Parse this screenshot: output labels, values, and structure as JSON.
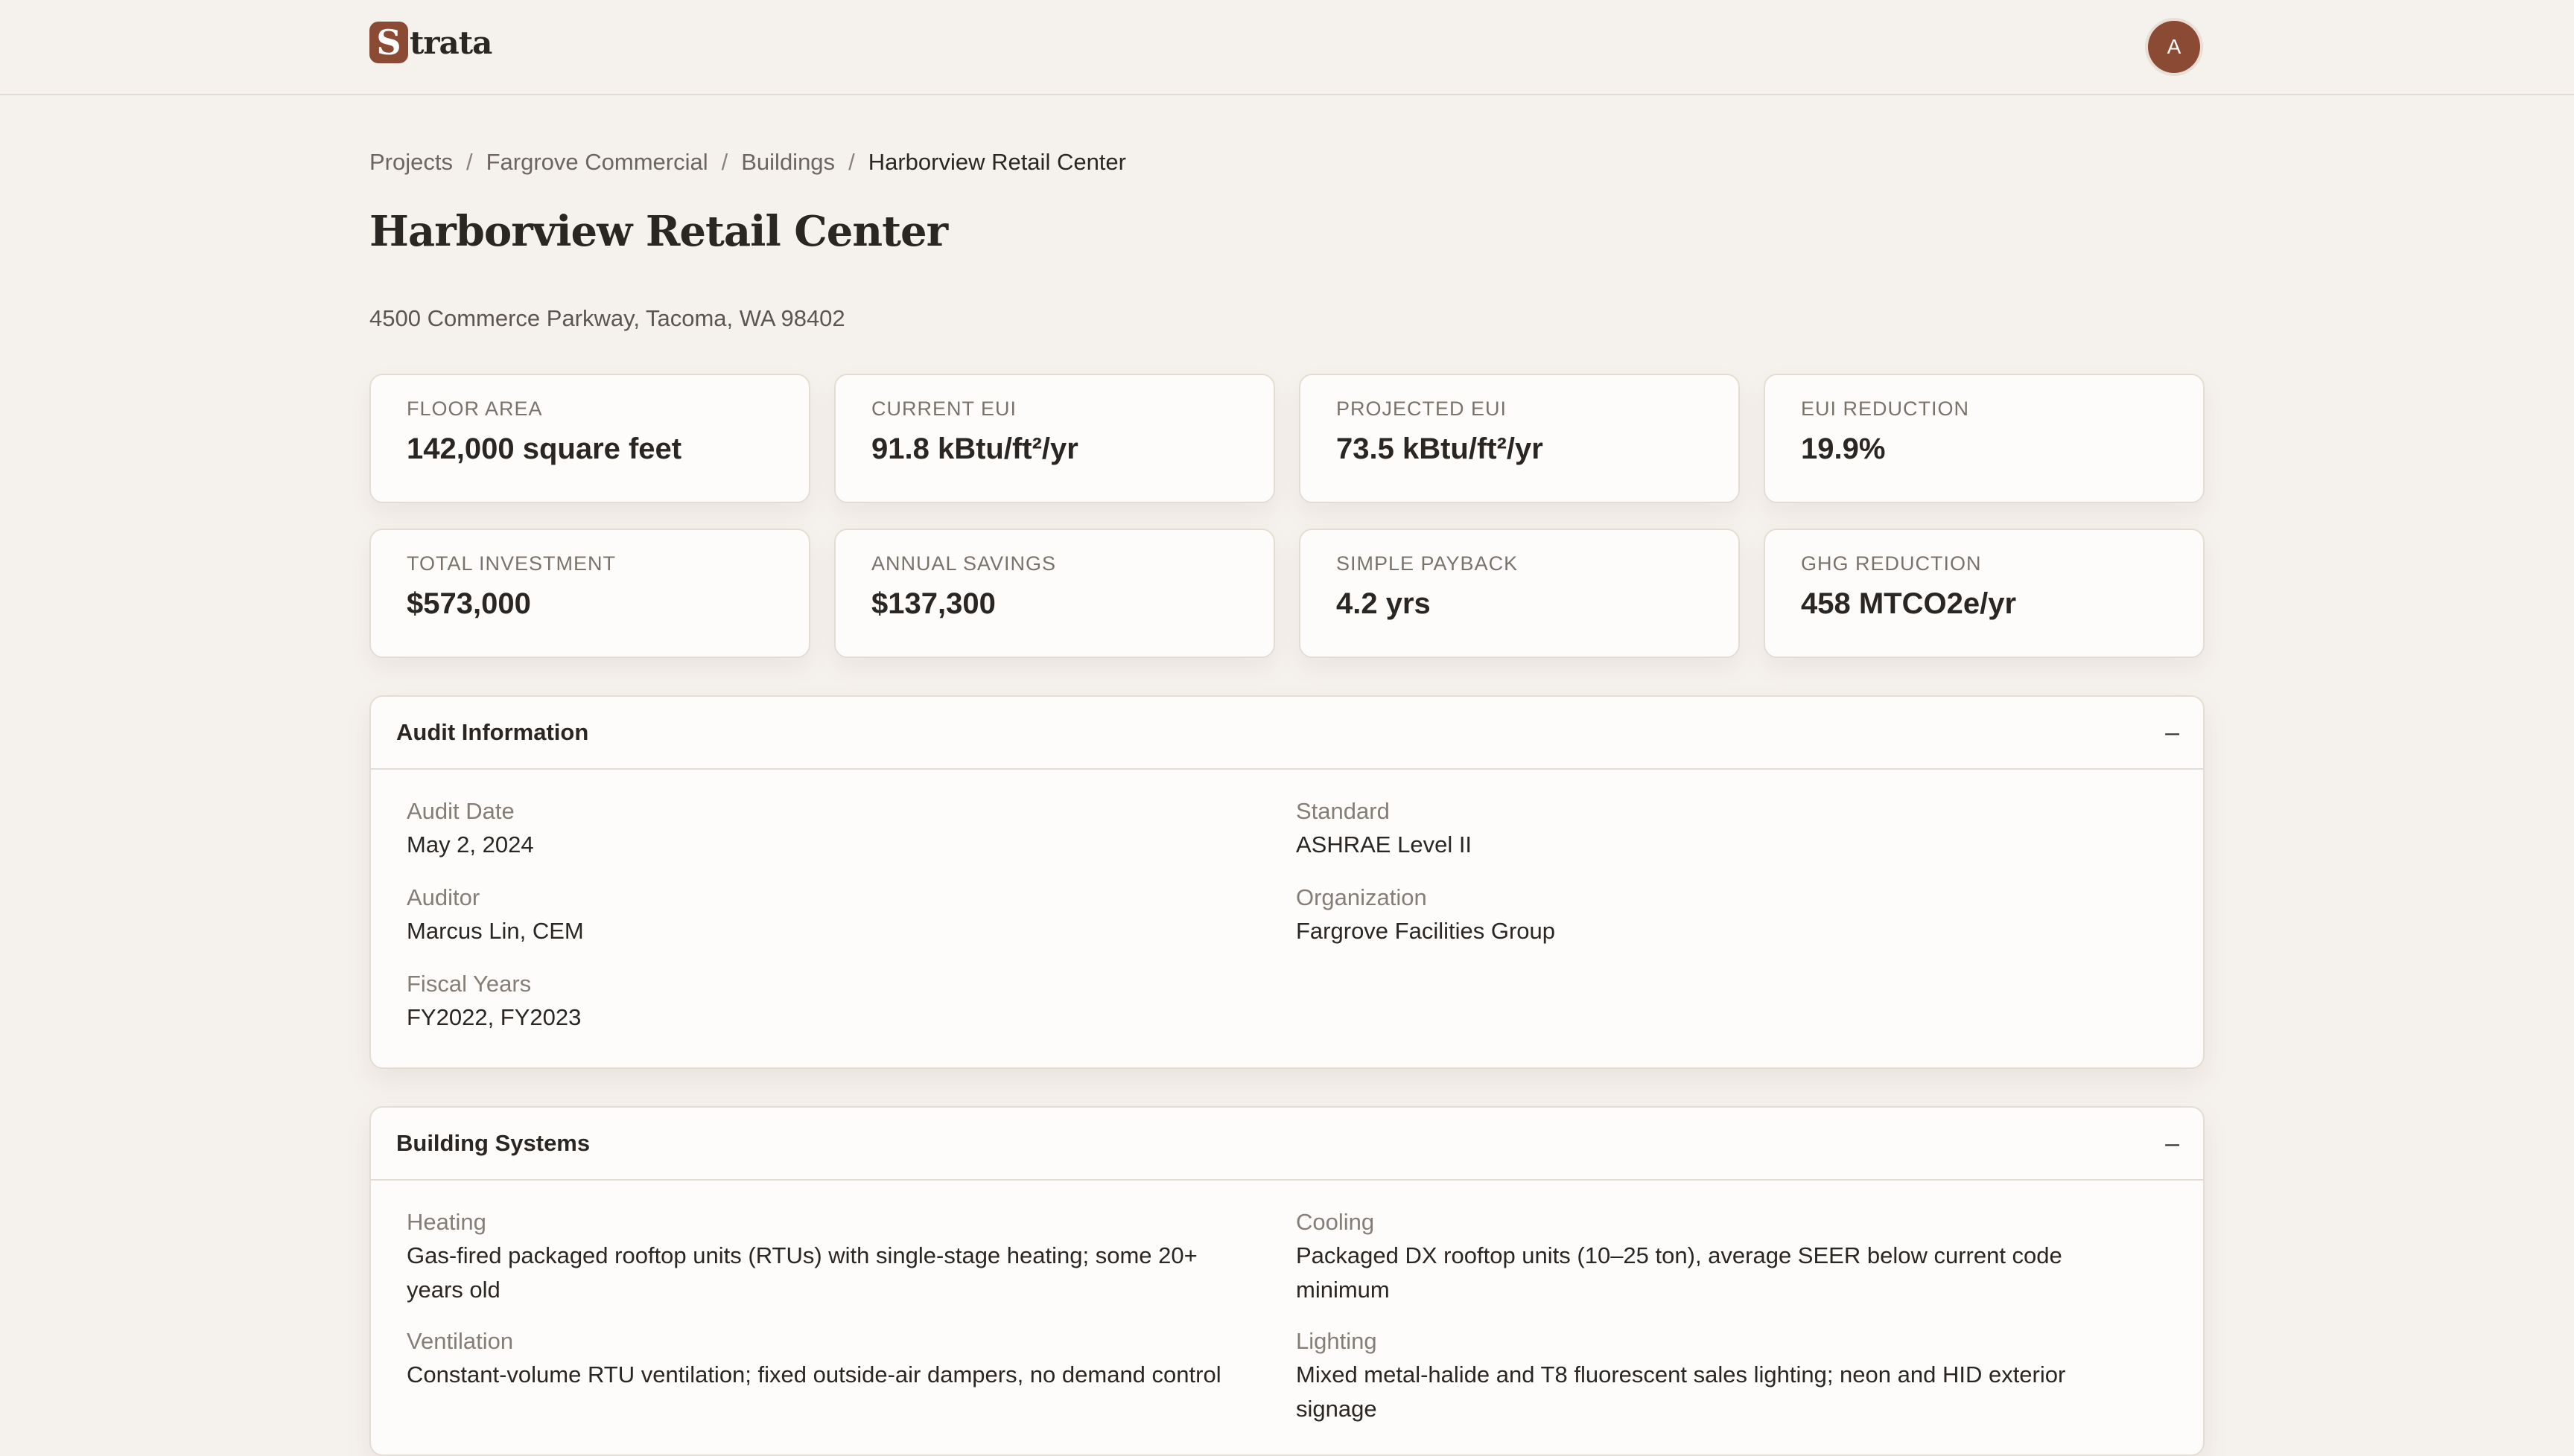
{
  "app": {
    "logo_letter": "S",
    "logo_text": "trata",
    "user_initial": "A"
  },
  "breadcrumb": [
    "Projects",
    "Fargrove Commercial",
    "Buildings",
    "Harborview Retail Center"
  ],
  "building": {
    "title": "Harborview Retail Center",
    "address": "4500 Commerce Parkway, Tacoma, WA 98402"
  },
  "stats": [
    {
      "label": "FLOOR AREA",
      "value": "142,000 square feet"
    },
    {
      "label": "CURRENT EUI",
      "value": "91.8 kBtu/ft²/yr"
    },
    {
      "label": "PROJECTED EUI",
      "value": "73.5 kBtu/ft²/yr"
    },
    {
      "label": "EUI REDUCTION",
      "value": "19.9%"
    },
    {
      "label": "TOTAL INVESTMENT",
      "value": "$573,000"
    },
    {
      "label": "ANNUAL SAVINGS",
      "value": "$137,300"
    },
    {
      "label": "SIMPLE PAYBACK",
      "value": "4.2 yrs"
    },
    {
      "label": "GHG REDUCTION",
      "value": "458 MTCO2e/yr"
    }
  ],
  "audit": {
    "title": "Audit Information",
    "toggle": "–",
    "fields": [
      {
        "label": "Audit Date",
        "value": "May 2, 2024"
      },
      {
        "label": "Standard",
        "value": "ASHRAE Level II"
      },
      {
        "label": "Auditor",
        "value": "Marcus Lin, CEM"
      },
      {
        "label": "Organization",
        "value": "Fargrove Facilities Group"
      },
      {
        "label": "Fiscal Years",
        "value": "FY2022, FY2023"
      }
    ]
  },
  "systems": {
    "title": "Building Systems",
    "toggle": "–",
    "fields": [
      {
        "label": "Heating",
        "value": "Gas-fired packaged rooftop units (RTUs) with single-stage heating; some 20+ years old"
      },
      {
        "label": "Cooling",
        "value": "Packaged DX rooftop units (10–25 ton), average SEER below current code minimum"
      },
      {
        "label": "Ventilation",
        "value": "Constant-volume RTU ventilation; fixed outside-air dampers, no demand control"
      },
      {
        "label": "Lighting",
        "value": "Mixed metal-halide and T8 fluorescent sales lighting; neon and HID exterior signage"
      }
    ]
  }
}
